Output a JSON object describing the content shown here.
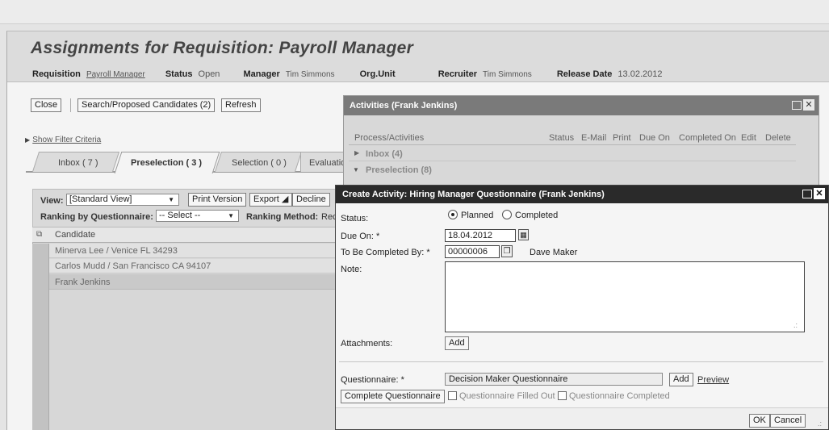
{
  "page": {
    "title": "Assignments for Requisition: Payroll Manager"
  },
  "header": {
    "requisition_label": "Requisition",
    "requisition_value": "Payroll Manager",
    "status_label": "Status",
    "status_value": "Open",
    "manager_label": "Manager",
    "manager_value": "Tim Simmons",
    "orgunit_label": "Org.Unit",
    "recruiter_label": "Recruiter",
    "recruiter_value": "Tim Simmons",
    "release_label": "Release Date",
    "release_value": "13.02.2012"
  },
  "toolbar": {
    "close": "Close",
    "search": "Search/Proposed Candidates (2)",
    "refresh": "Refresh"
  },
  "filter": {
    "label": "Show Filter Criteria"
  },
  "tabs": [
    {
      "label": "Inbox ( 7 )"
    },
    {
      "label": "Preselection ( 3 )"
    },
    {
      "label": "Selection ( 0 )"
    },
    {
      "label": "Evaluatio"
    }
  ],
  "view": {
    "label": "View:",
    "value": "[Standard View]",
    "print": "Print Version",
    "export": "Export ◢",
    "decline": "Decline"
  },
  "ranking": {
    "label": "Ranking by Questionnaire:",
    "value": "-- Select --",
    "method_label": "Ranking Method:",
    "method_value": "Rec"
  },
  "table": {
    "header": "Candidate",
    "rows": [
      {
        "candidate": "Minerva Lee / Venice FL 34293"
      },
      {
        "candidate": "Carlos Mudd / San Francisco CA 94107"
      },
      {
        "candidate": "Frank Jenkins"
      }
    ]
  },
  "activities": {
    "title": "Activities (Frank Jenkins)",
    "columns": [
      "Process/Activities",
      "Status",
      "E-Mail",
      "Print",
      "Due On",
      "Completed On",
      "Edit",
      "Delete"
    ],
    "rows": [
      {
        "label": "Inbox (4)"
      },
      {
        "label": "Preselection (8)"
      }
    ]
  },
  "dialog": {
    "title": "Create Activity: Hiring Manager Questionnaire (Frank Jenkins)",
    "status_label": "Status:",
    "planned": "Planned",
    "completed": "Completed",
    "due_label": "Due On: *",
    "due_value": "18.04.2012",
    "completed_by_label": "To Be Completed By: *",
    "completed_by_value": "00000006",
    "completed_by_name": "Dave Maker",
    "note_label": "Note:",
    "attachments_label": "Attachments:",
    "add": "Add",
    "questionnaire_label": "Questionnaire: *",
    "questionnaire_value": "Decision Maker Questionnaire",
    "add2": "Add",
    "preview": "Preview",
    "complete_btn": "Complete Questionnaire",
    "filled_out": "Questionnaire Filled Out",
    "q_completed": "Questionnaire Completed",
    "ok": "OK",
    "cancel": "Cancel"
  }
}
